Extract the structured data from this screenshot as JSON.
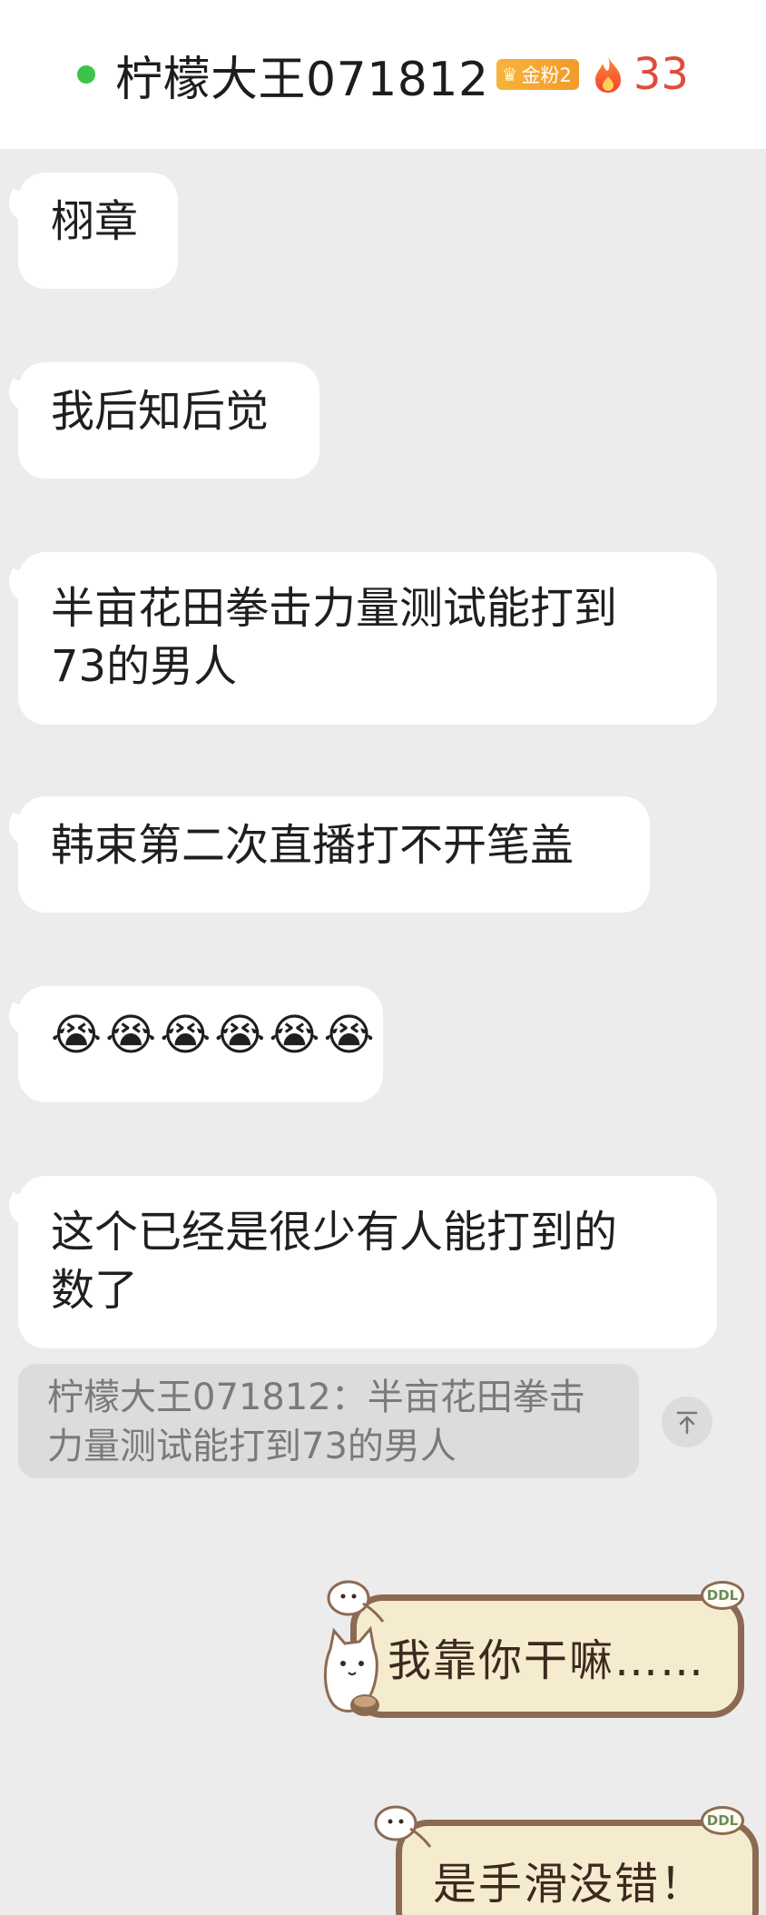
{
  "header": {
    "contact_name": "柠檬大王071812",
    "fan_badge": "金粉2",
    "streak_count": "33",
    "colors": {
      "online": "#3cc34a",
      "badge": "#f29b2a",
      "streak": "#e04b3a"
    }
  },
  "messages": [
    {
      "text": "栩章"
    },
    {
      "text": "我后知后觉"
    },
    {
      "line1": "半亩花田拳击力量测试能打到",
      "line2": "73的男人"
    },
    {
      "text": "韩束第二次直播打不开笔盖"
    },
    {
      "emojis": [
        "😭",
        "😭",
        "😭",
        "😭",
        "😭",
        "😭"
      ],
      "emoji_name": "crying-face"
    },
    {
      "line1": "这个已经是很少有人能打到的",
      "line2": "数了"
    }
  ],
  "quote": {
    "line1": "柠檬大王071812：半亩花田拳击",
    "line2": "力量测试能打到73的男人"
  },
  "outgoing": [
    {
      "text": "我靠你干嘛……",
      "tag": "DDL"
    },
    {
      "text": "是手滑没错！",
      "tag": "DDL"
    }
  ],
  "badge_symbol": "♛"
}
